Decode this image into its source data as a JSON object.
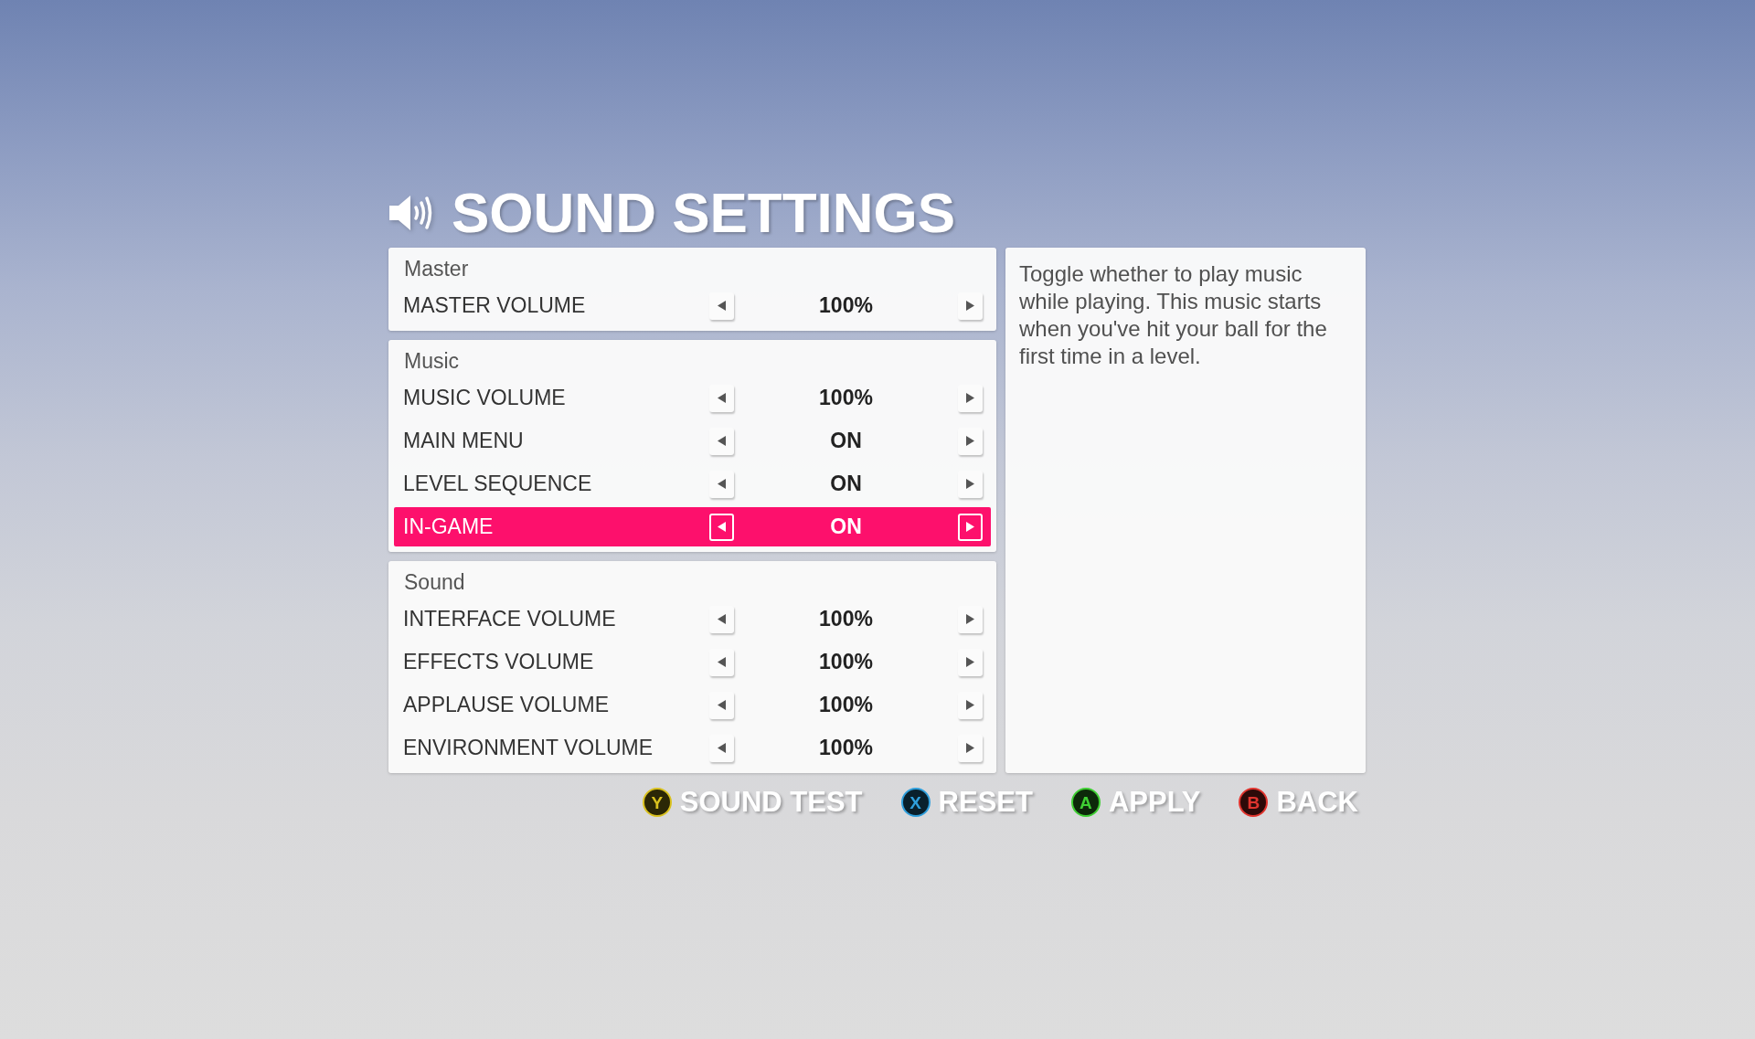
{
  "title": "SOUND SETTINGS",
  "sections": [
    {
      "heading": "Master",
      "rows": [
        {
          "label": "MASTER VOLUME",
          "value": "100%",
          "selected": false
        }
      ]
    },
    {
      "heading": "Music",
      "rows": [
        {
          "label": "MUSIC VOLUME",
          "value": "100%",
          "selected": false
        },
        {
          "label": "MAIN MENU",
          "value": "ON",
          "selected": false
        },
        {
          "label": "LEVEL SEQUENCE",
          "value": "ON",
          "selected": false
        },
        {
          "label": "IN-GAME",
          "value": "ON",
          "selected": true
        }
      ]
    },
    {
      "heading": "Sound",
      "rows": [
        {
          "label": "INTERFACE VOLUME",
          "value": "100%",
          "selected": false
        },
        {
          "label": "EFFECTS VOLUME",
          "value": "100%",
          "selected": false
        },
        {
          "label": "APPLAUSE VOLUME",
          "value": "100%",
          "selected": false
        },
        {
          "label": "ENVIRONMENT VOLUME",
          "value": "100%",
          "selected": false
        }
      ]
    }
  ],
  "description": "Toggle whether to play music while playing. This music starts when you've hit your ball for the first time in a level.",
  "prompts": [
    {
      "key": "Y",
      "label": "SOUND TEST",
      "color": "#d9c11f"
    },
    {
      "key": "X",
      "label": "RESET",
      "color": "#2f9fdc"
    },
    {
      "key": "A",
      "label": "APPLY",
      "color": "#3fcf33"
    },
    {
      "key": "B",
      "label": "BACK",
      "color": "#e0342e"
    }
  ]
}
